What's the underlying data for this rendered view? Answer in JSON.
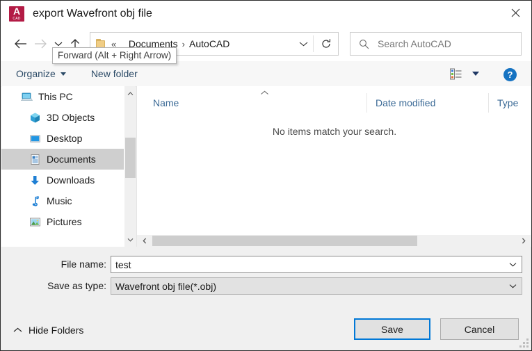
{
  "window": {
    "title": "export Wavefront obj file",
    "app_icon": "autocad-icon",
    "app_icon_letter": "A",
    "app_icon_sub": "CAD",
    "close_label": "✕",
    "accent_color": "#0078d7",
    "app_icon_color": "#b31b45"
  },
  "nav": {
    "back": "back-arrow",
    "forward": "forward-arrow",
    "recent": "recent-locations-chevron",
    "up": "up-arrow",
    "refresh": "refresh-icon",
    "breadcrumb": {
      "ellipsis": "«",
      "separator": "›",
      "items": [
        "Documents",
        "AutoCAD"
      ]
    },
    "tooltip": "Forward (Alt + Right Arrow)"
  },
  "search": {
    "placeholder": "Search AutoCAD",
    "icon": "search-icon"
  },
  "toolbar": {
    "organize_label": "Organize",
    "new_folder_label": "New folder",
    "view_icon": "view-layout-icon",
    "view_caret": "chevron-down-icon",
    "help_label": "?"
  },
  "sidebar": {
    "items": [
      {
        "label": "This PC",
        "icon": "this-pc-icon",
        "indent": false,
        "selected": false
      },
      {
        "label": "3D Objects",
        "icon": "3d-objects-icon",
        "indent": true,
        "selected": false
      },
      {
        "label": "Desktop",
        "icon": "desktop-icon",
        "indent": true,
        "selected": false
      },
      {
        "label": "Documents",
        "icon": "documents-icon",
        "indent": true,
        "selected": true
      },
      {
        "label": "Downloads",
        "icon": "downloads-icon",
        "indent": true,
        "selected": false
      },
      {
        "label": "Music",
        "icon": "music-icon",
        "indent": true,
        "selected": false
      },
      {
        "label": "Pictures",
        "icon": "pictures-icon",
        "indent": true,
        "selected": false
      }
    ]
  },
  "filelist": {
    "columns": [
      "Name",
      "Date modified",
      "Type"
    ],
    "sort_indicator": "sort-ascending-icon",
    "rows": [],
    "empty_message": "No items match your search."
  },
  "form": {
    "file_name_label": "File name:",
    "file_name_value": "test",
    "save_as_type_label": "Save as type:",
    "save_as_type_value": "Wavefront obj file(*.obj)"
  },
  "footer": {
    "hide_folders_label": "Hide Folders",
    "save_label": "Save",
    "cancel_label": "Cancel"
  }
}
